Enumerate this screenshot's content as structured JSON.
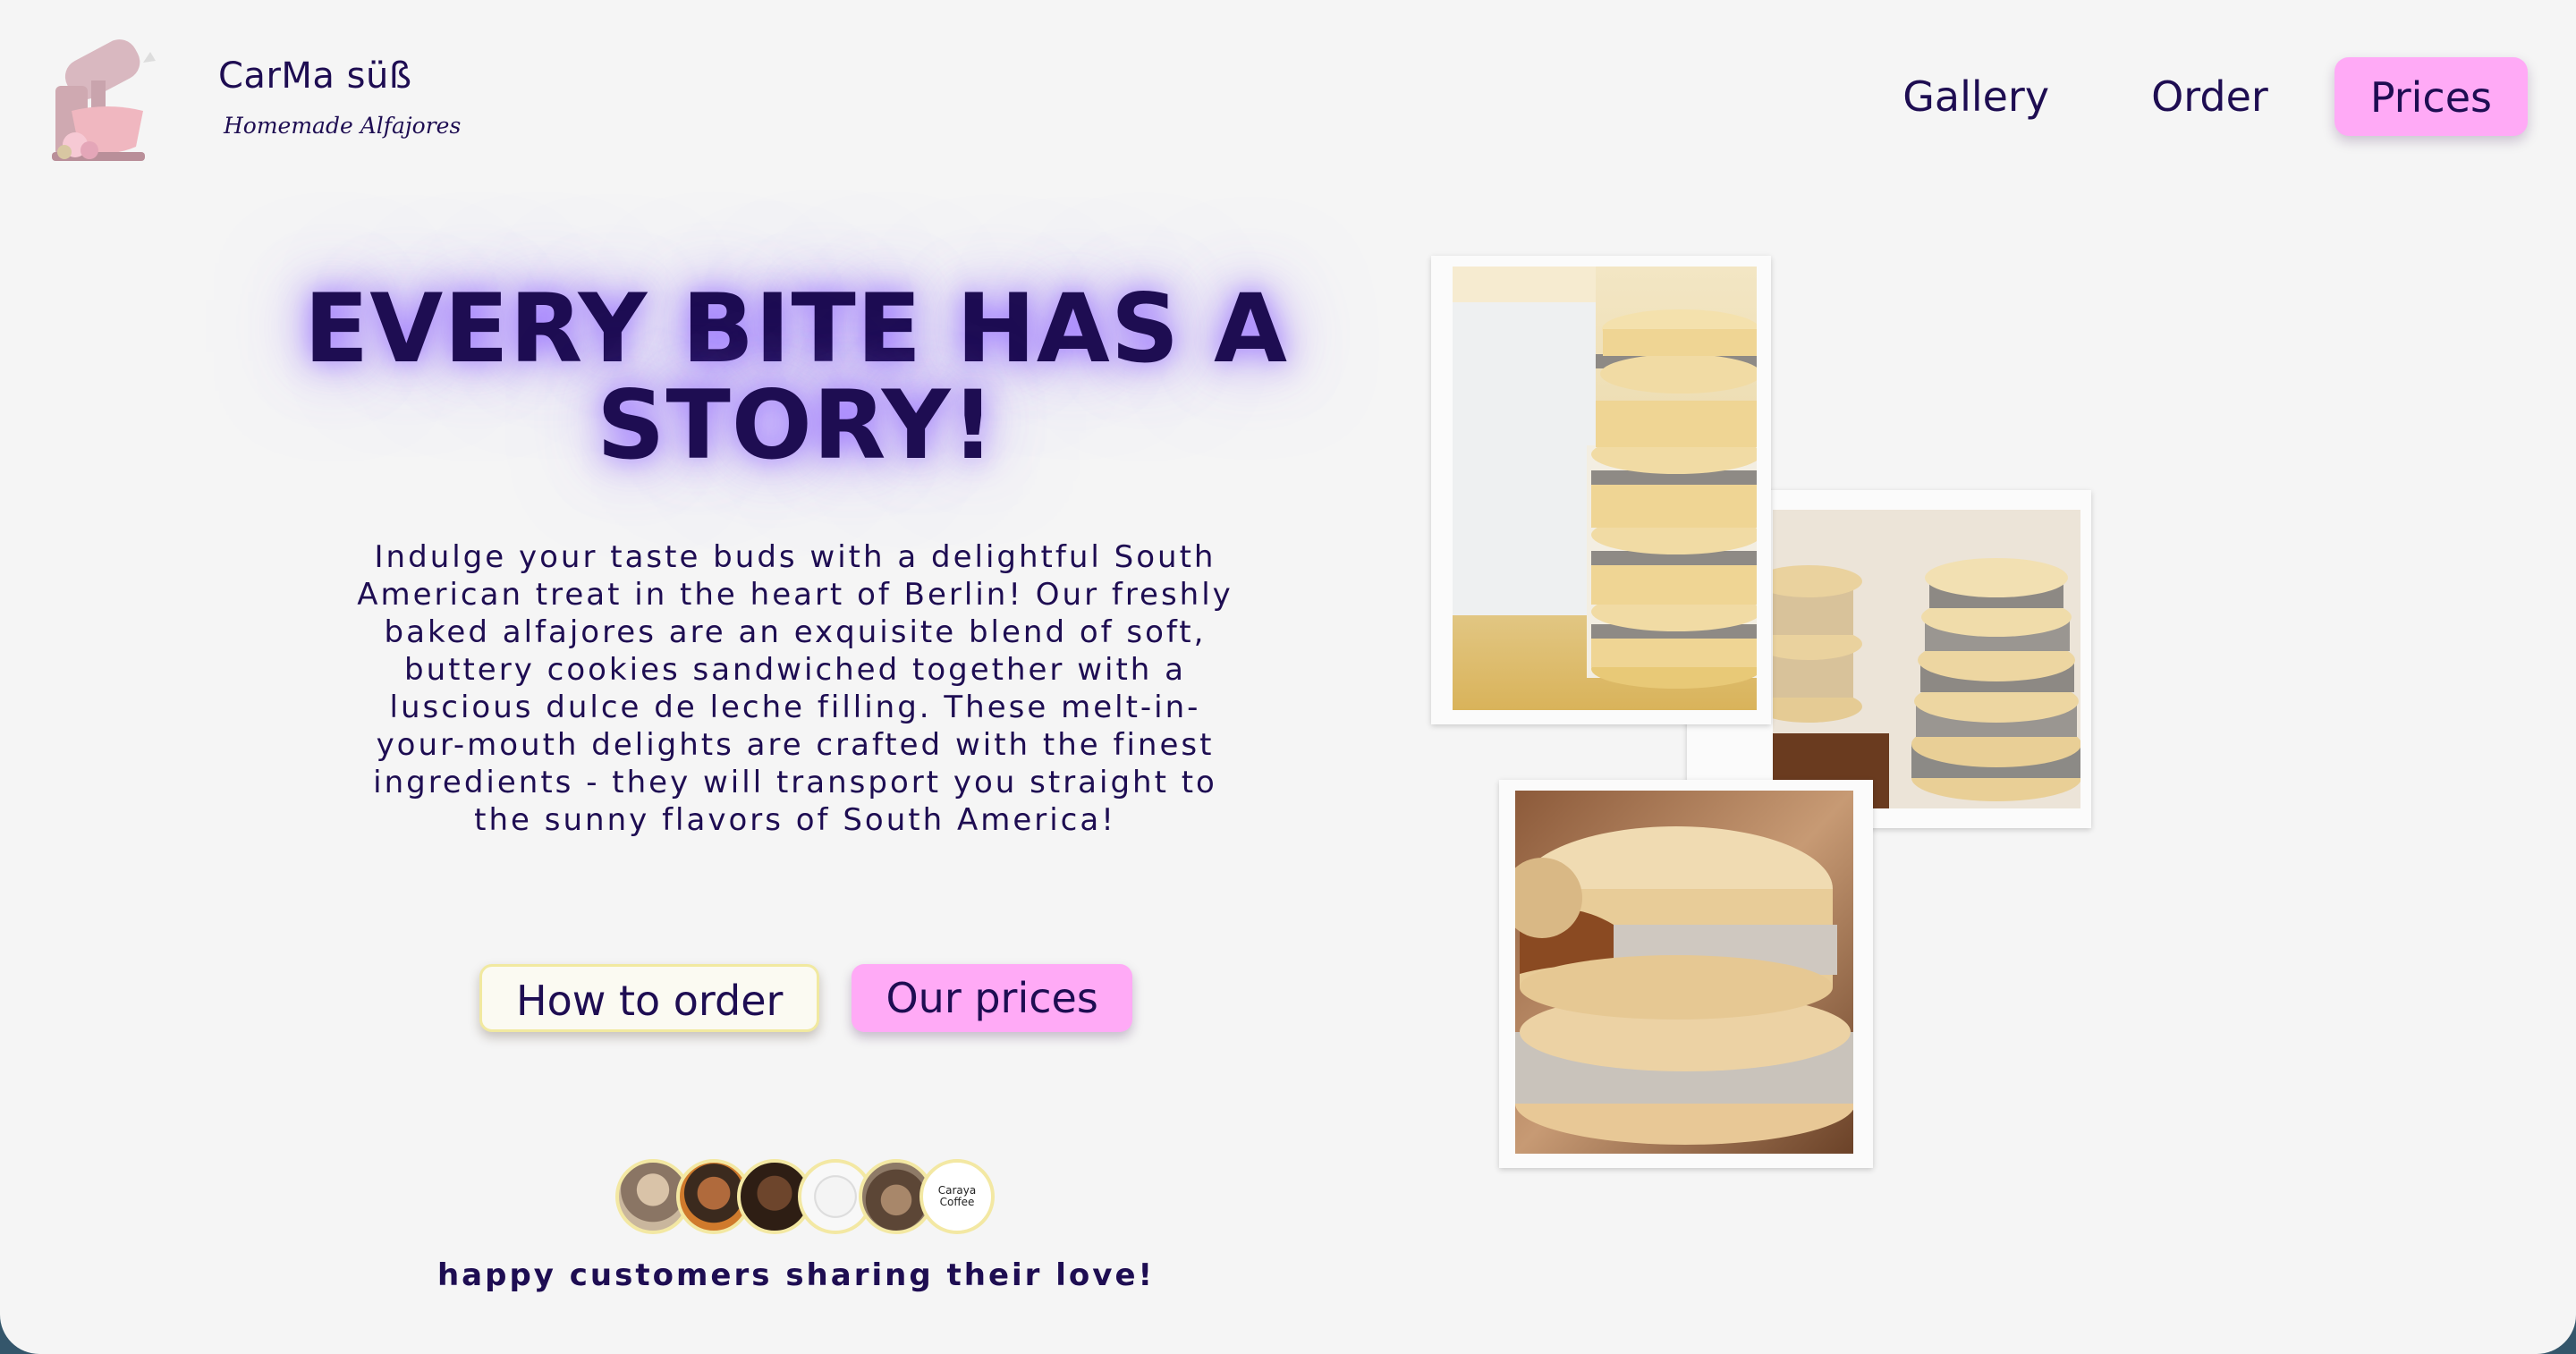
{
  "brand": {
    "name": "CarMa süß",
    "tagline": "Homemade Alfajores",
    "logo_icon": "stand-mixer-icon"
  },
  "nav": {
    "gallery": "Gallery",
    "order": "Order",
    "prices": "Prices"
  },
  "hero": {
    "title_line1": "EVERY BITE HAS A",
    "title_line2": "STORY!",
    "body": "Indulge your taste buds with a delightful South American treat in the heart of Berlin! Our freshly baked alfajores are an exquisite blend of soft, buttery cookies sandwiched together with a luscious dulce de leche filling. These melt-in-your-mouth delights are crafted with the finest ingredients - they will transport you straight to the sunny flavors of South America!"
  },
  "cta": {
    "how_to_order": "How to order",
    "our_prices": "Our prices"
  },
  "customers": {
    "text": "happy customers sharing their love!",
    "avatar_label": "Caraya Coffee"
  },
  "colors": {
    "text": "#1e0d52",
    "accent_pink": "#ffaaf6",
    "outline_yellow": "#f1e9a0",
    "background": "#f5f5f5"
  }
}
